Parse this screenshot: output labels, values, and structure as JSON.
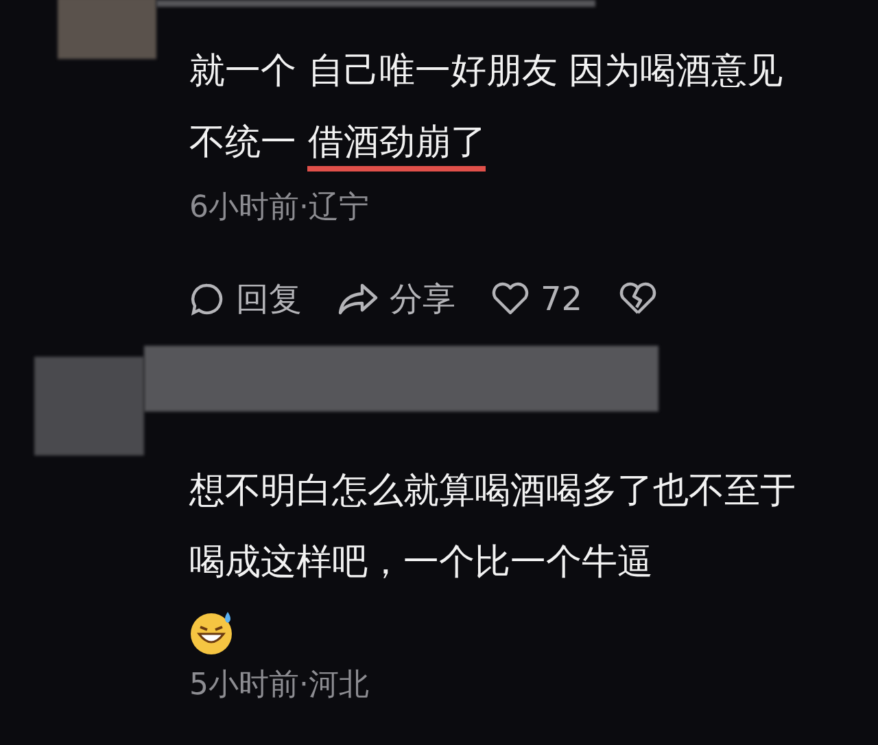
{
  "comments": [
    {
      "text": [
        {
          "s": "就一个 自己唯一好朋友 因为喝酒意见不统一 ",
          "underlined": false
        },
        {
          "s": "借酒劲崩了",
          "underlined": true
        }
      ],
      "has_emoji": false,
      "meta": "6小时前·辽宁",
      "actions": {
        "reply": "回复",
        "share": "分享",
        "likes": "72"
      }
    },
    {
      "text": [
        {
          "s": "想不明白怎么就算喝酒喝多了也不至于喝成这样吧，一个比一个牛逼",
          "underlined": false
        }
      ],
      "has_emoji": true,
      "meta": "5小时前·河北"
    }
  ]
}
